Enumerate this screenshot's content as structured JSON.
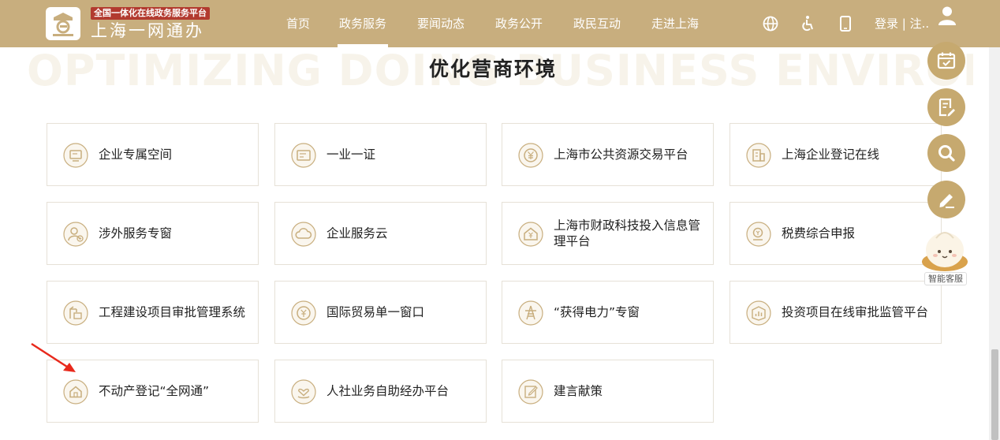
{
  "header": {
    "logo_sub": "全国一体化在线政务服务平台",
    "logo_main": "上海一网通办",
    "nav": [
      {
        "label": "首页",
        "active": false
      },
      {
        "label": "政务服务",
        "active": true
      },
      {
        "label": "要闻动态",
        "active": false
      },
      {
        "label": "政务公开",
        "active": false
      },
      {
        "label": "政民互动",
        "active": false
      },
      {
        "label": "走进上海",
        "active": false
      }
    ],
    "icons": [
      "globe-icon",
      "accessibility-icon",
      "mobile-icon"
    ],
    "login_text": "登录 | 注..",
    "accent_color": "#c8ae7e"
  },
  "section": {
    "bg_text": "OPTIMIZING DOING BUSINESS ENVIRONMENT",
    "title": "优化营商环境"
  },
  "cards": [
    {
      "label": "企业专属空间",
      "icon": "monitor-icon"
    },
    {
      "label": "一业一证",
      "icon": "certificate-icon"
    },
    {
      "label": "上海市公共资源交易平台",
      "icon": "yuan-coin-icon"
    },
    {
      "label": "上海企业登记在线",
      "icon": "building-icon"
    },
    {
      "label": "涉外服务专窗",
      "icon": "user-plus-icon"
    },
    {
      "label": "企业服务云",
      "icon": "cloud-icon"
    },
    {
      "label": "上海市财政科技投入信息管理平台",
      "icon": "house-finance-icon"
    },
    {
      "label": "税费综合申报",
      "icon": "tax-icon"
    },
    {
      "label": "工程建设项目审批管理系统",
      "icon": "construction-icon"
    },
    {
      "label": "国际贸易单一窗口",
      "icon": "globe-yuan-icon"
    },
    {
      "label": "“获得电力”专窗",
      "icon": "power-tower-icon"
    },
    {
      "label": "投资项目在线审批监管平台",
      "icon": "chart-box-icon"
    },
    {
      "label": "不动产登记“全网通”",
      "icon": "home-icon"
    },
    {
      "label": "人社业务自助经办平台",
      "icon": "heart-hand-icon"
    },
    {
      "label": "建言献策",
      "icon": "edit-box-icon"
    }
  ],
  "float_tools": [
    "calendar-check-icon",
    "form-edit-icon",
    "search-icon",
    "pencil-icon"
  ],
  "assistant_label": "智能客服"
}
